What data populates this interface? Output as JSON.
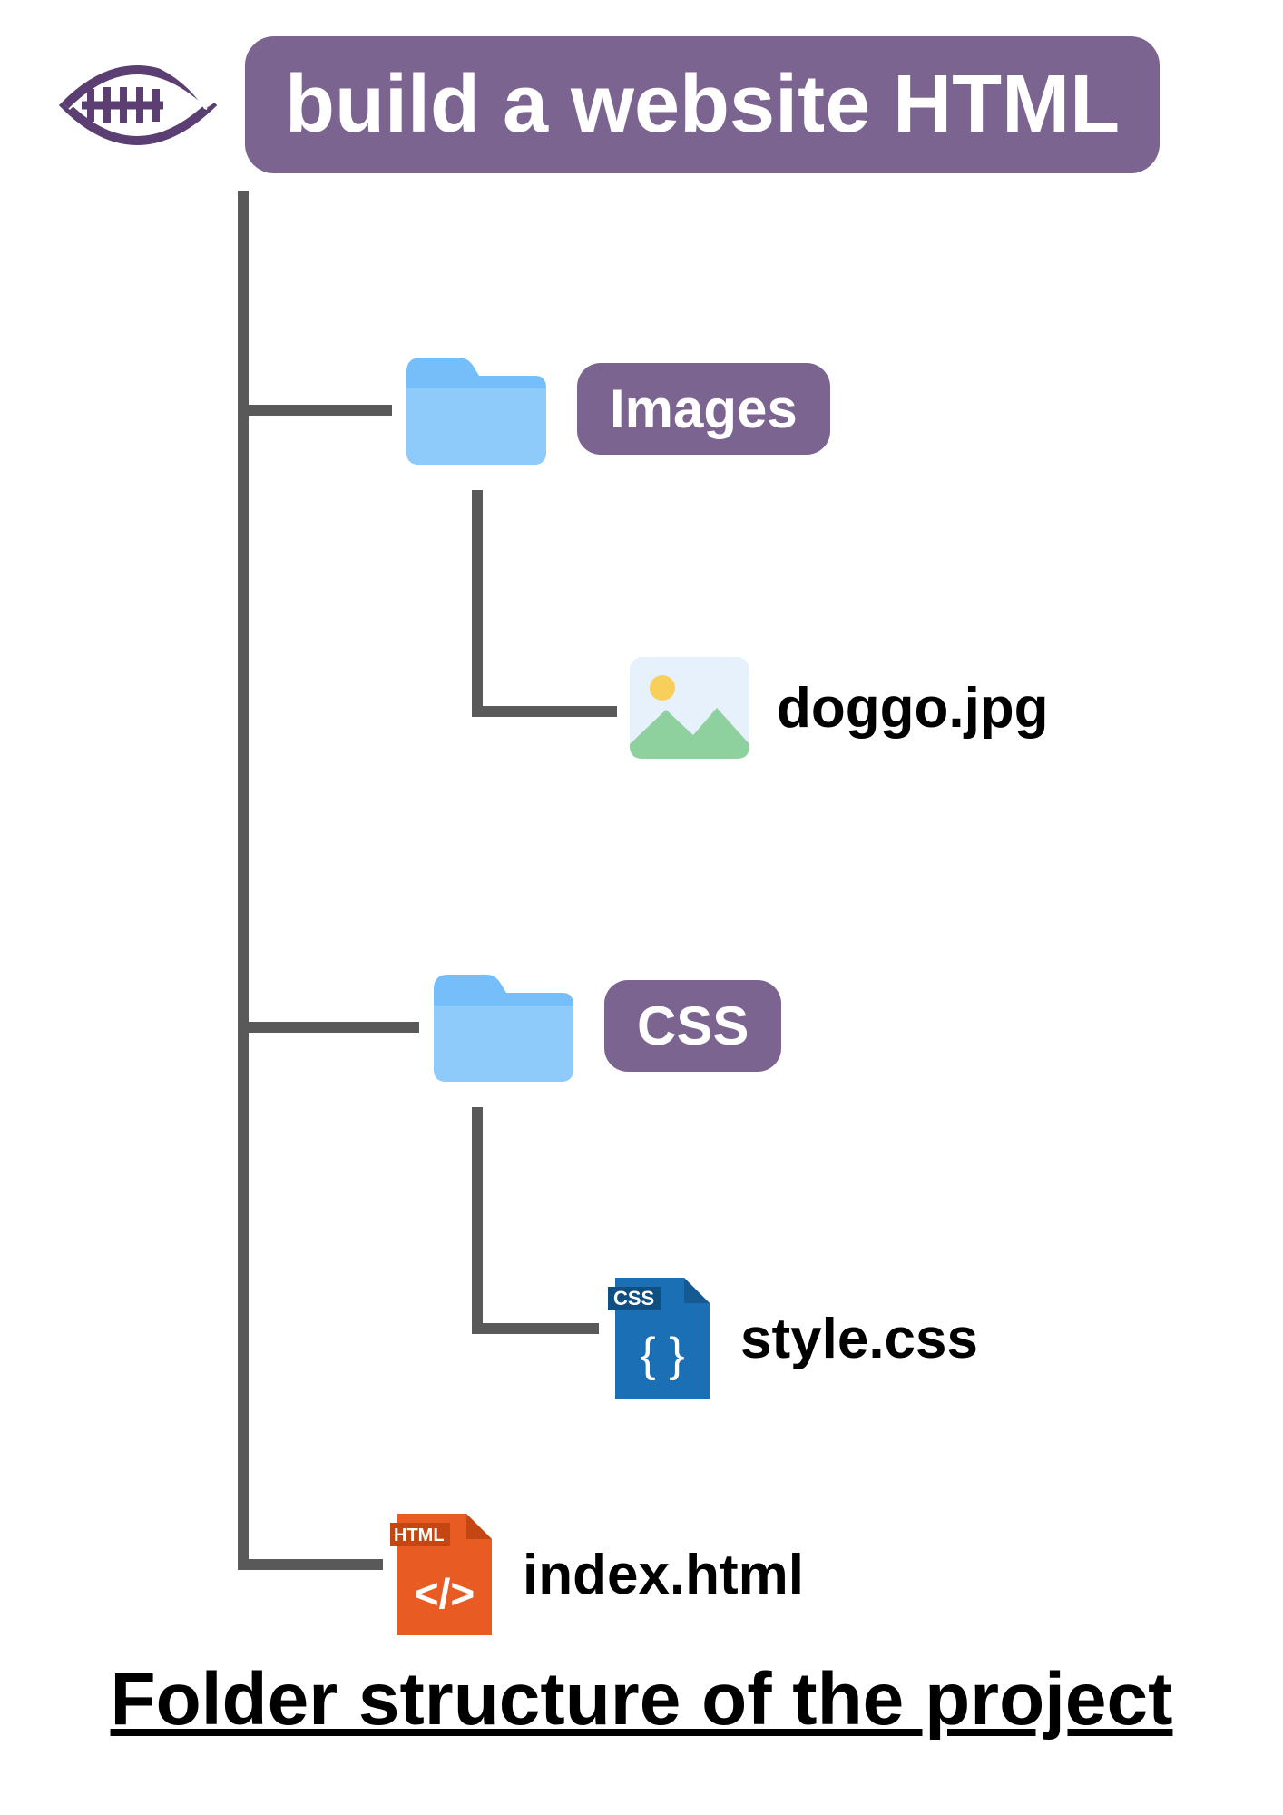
{
  "root": {
    "title": "build a website HTML"
  },
  "tree": {
    "images_folder": {
      "label": "Images"
    },
    "images_file": {
      "name": "doggo.jpg"
    },
    "css_folder": {
      "label": "CSS"
    },
    "css_file": {
      "name": "style.css",
      "badge": "CSS"
    },
    "html_file": {
      "name": "index.html",
      "badge": "HTML"
    }
  },
  "caption": "Folder structure of the project",
  "colors": {
    "purple": "#7b648f",
    "folder_blue": "#75befa",
    "line_gray": "#595959",
    "css_blue": "#1b70b5",
    "html_orange": "#e85c24"
  }
}
